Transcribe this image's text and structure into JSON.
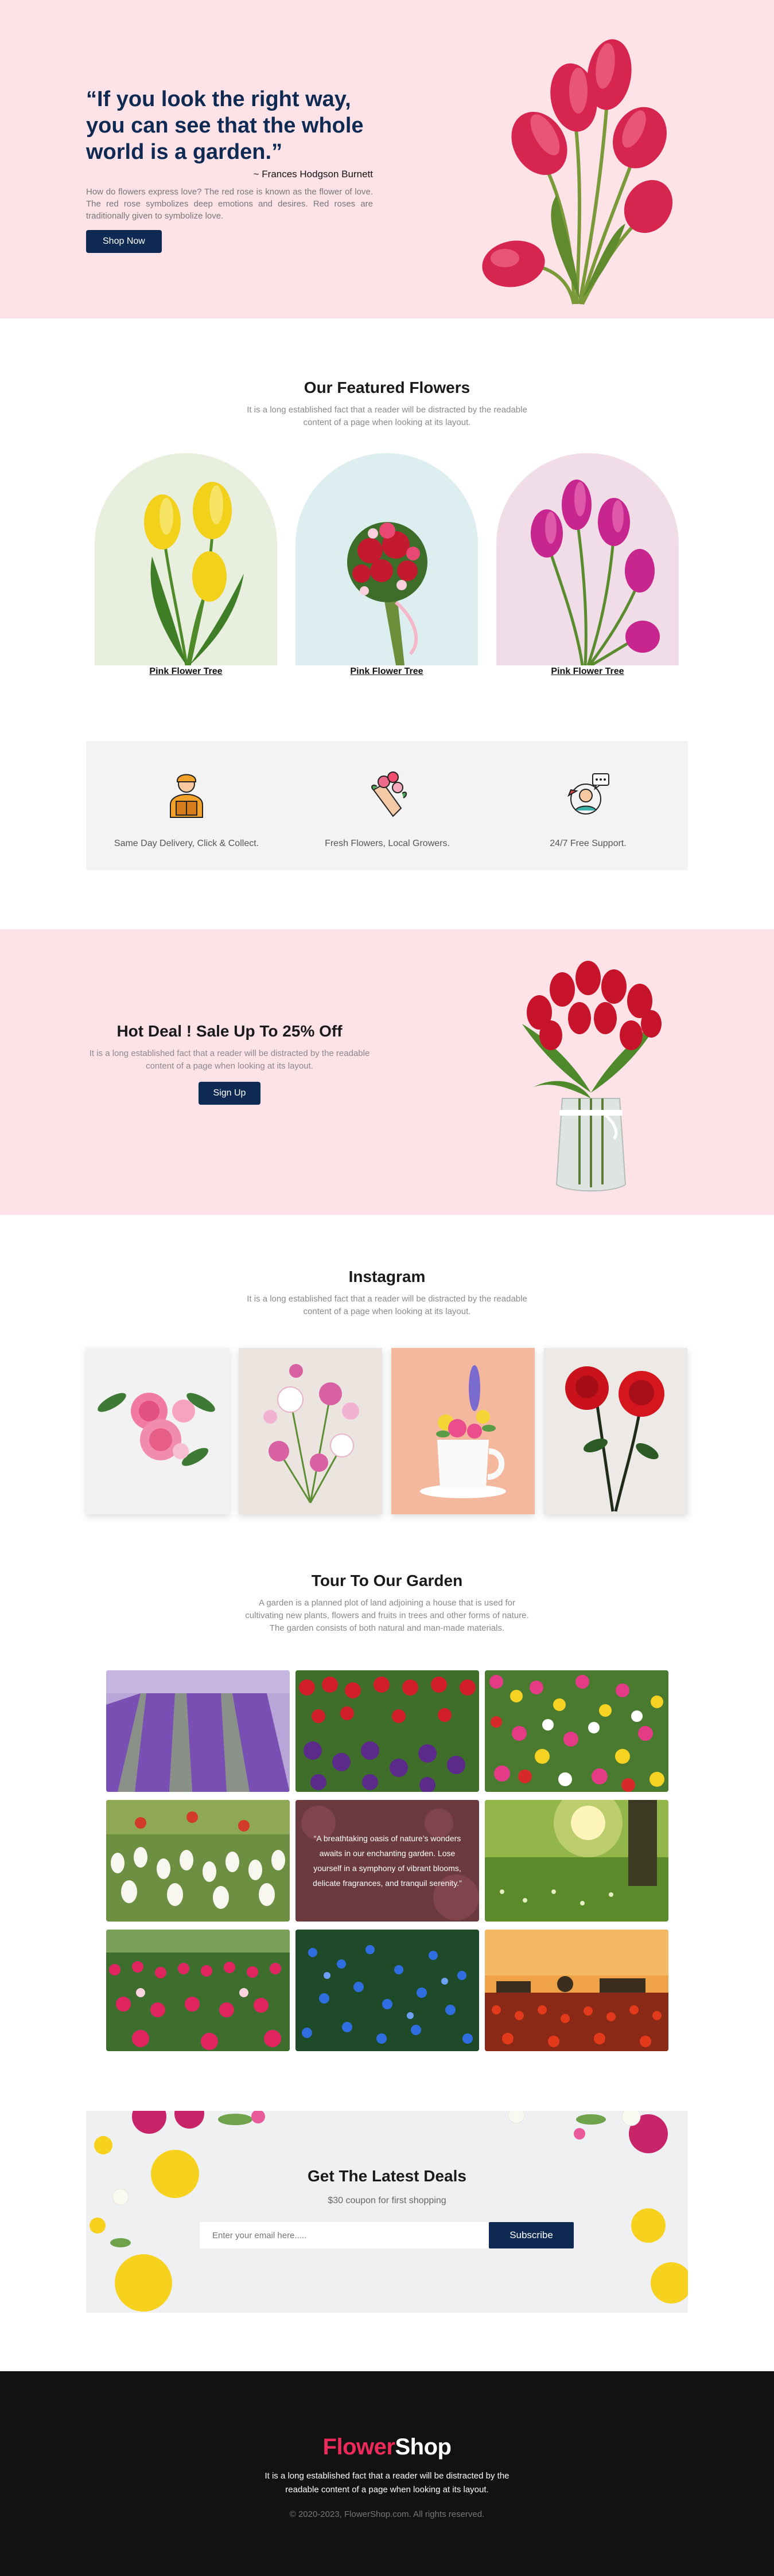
{
  "hero": {
    "quote": "“If you look the right way, you can see that the whole world is a garden.”",
    "author": "~ Frances Hodgson Burnett",
    "description": "How do flowers express love? The red rose is known as the flower of love. The red rose symbolizes deep emotions and desires. Red roses are traditionally given to symbolize love.",
    "button": "Shop Now"
  },
  "featured": {
    "title": "Our Featured Flowers",
    "subtitle": "It is a long established fact that a reader will be distracted by the readable content of a page when looking at its layout.",
    "items": [
      {
        "label": "Pink Flower Tree",
        "bg": "#e8efde"
      },
      {
        "label": "Pink Flower Tree",
        "bg": "#ddeef0"
      },
      {
        "label": "Pink Flower Tree",
        "bg": "#f0dde8"
      }
    ]
  },
  "features": [
    {
      "icon": "delivery-man-icon",
      "label": "Same Day Delivery, Click & Collect."
    },
    {
      "icon": "bouquet-icon",
      "label": "Fresh Flowers, Local Growers."
    },
    {
      "icon": "support-icon",
      "label": "24/7 Free Support."
    }
  ],
  "deal": {
    "title": "Hot Deal ! Sale Up To 25% Off",
    "subtitle": "It is a long established fact that a reader will be distracted by the readable content of a page when looking at its layout.",
    "button": "Sign Up"
  },
  "instagram": {
    "title": "Instagram",
    "subtitle": "It is a long established fact that a reader will be distracted by the readable content of a page when looking at its layout."
  },
  "tour": {
    "title": "Tour To Our Garden",
    "subtitle": "A garden is a planned plot of land adjoining a house that is used for cultivating new plants, flowers and fruits in trees and other forms of nature. The garden consists of both natural and man-made materials.",
    "caption": "“A breathtaking oasis of nature’s wonders awaits in our enchanting garden. Lose yourself in a symphony of vibrant blooms, delicate fragrances, and tranquil serenity.”"
  },
  "newsletter": {
    "title": "Get The Latest Deals",
    "subtitle": "$30 coupon for first shopping",
    "placeholder": "Enter your email here.....",
    "button": "Subscribe"
  },
  "footer": {
    "logo_part1": "Flower",
    "logo_part2": "Shop",
    "description": "It is a long established fact that a reader will be distracted by the readable content of a page when looking at its layout.",
    "copyright": "© 2020-2023, FlowerShop.com. All rights reserved."
  },
  "colors": {
    "navy": "#0e2a52",
    "pink_bg": "#fde2e7",
    "brand": "#ee2a5b",
    "footer_bg": "#121212"
  }
}
